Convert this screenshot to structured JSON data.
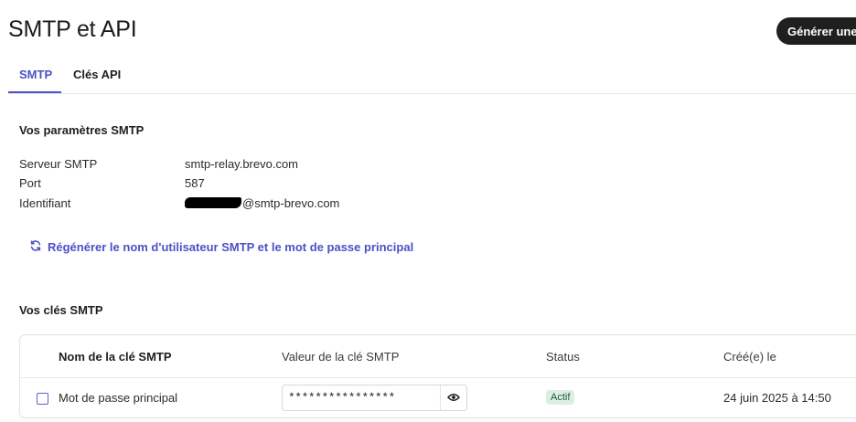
{
  "header": {
    "title": "SMTP et API",
    "generate_button": "Générer une"
  },
  "tabs": [
    {
      "label": "SMTP",
      "active": true
    },
    {
      "label": "Clés API",
      "active": false
    }
  ],
  "smtp_params": {
    "title": "Vos paramètres SMTP",
    "rows": [
      {
        "label": "Serveur SMTP",
        "value": "smtp-relay.brevo.com"
      },
      {
        "label": "Port",
        "value": "587"
      },
      {
        "label": "Identifiant",
        "value": "@smtp-brevo.com"
      }
    ],
    "regen_link": "Régénérer le nom d'utilisateur SMTP et le mot de passe principal"
  },
  "smtp_keys": {
    "title": "Vos clés SMTP",
    "columns": [
      "Nom de la clé SMTP",
      "Valeur de la clé SMTP",
      "Status",
      "Créé(e) le"
    ],
    "rows": [
      {
        "name": "Mot de passe principal",
        "value": "****************",
        "status": "Actif",
        "created": "24 juin 2025 à 14:50"
      }
    ]
  },
  "colors": {
    "accent": "#4a52c6",
    "dark_button": "#1f1f1f",
    "status_bg": "#dcefe3"
  },
  "icons": {
    "regen": "refresh-icon",
    "reveal": "eye-icon"
  }
}
